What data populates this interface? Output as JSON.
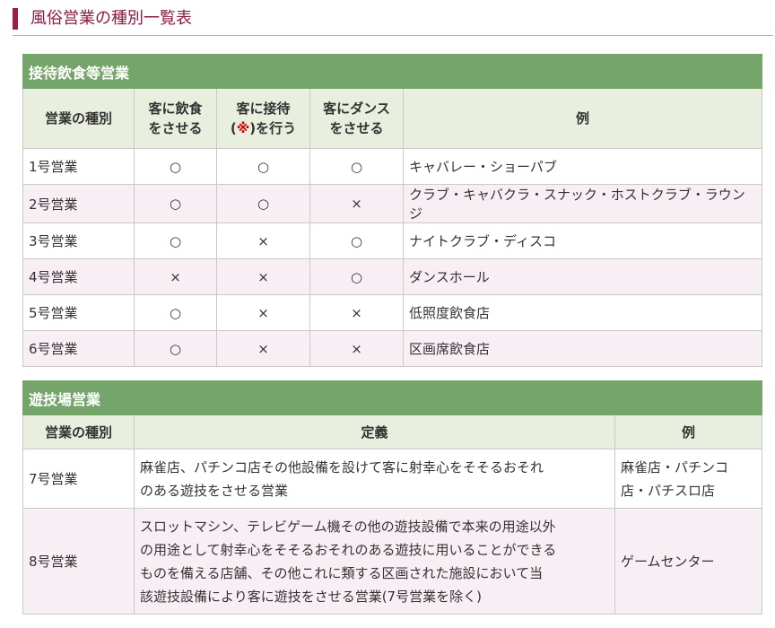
{
  "heading": {
    "title": "風俗営業の種別一覧表"
  },
  "table1": {
    "caption": "接待飲食等営業",
    "headers": {
      "type": "営業の種別",
      "food_1": "客に飲食",
      "food_2": "をさせる",
      "entertain_1": "客に接待",
      "entertain_2a": "(",
      "entertain_mark": "※",
      "entertain_2b": ")を行う",
      "dance_1": "客にダンス",
      "dance_2": "をさせる",
      "example": "例"
    },
    "rows": [
      {
        "type": "1号営業",
        "food": "○",
        "entertain": "○",
        "dance": "○",
        "example": "キャバレー・ショーパブ"
      },
      {
        "type": "2号営業",
        "food": "○",
        "entertain": "○",
        "dance": "×",
        "example": "クラブ・キャバクラ・スナック・ホストクラブ・ラウンジ"
      },
      {
        "type": "3号営業",
        "food": "○",
        "entertain": "×",
        "dance": "○",
        "example": "ナイトクラブ・ディスコ"
      },
      {
        "type": "4号営業",
        "food": "×",
        "entertain": "×",
        "dance": "○",
        "example": "ダンスホール"
      },
      {
        "type": "5号営業",
        "food": "○",
        "entertain": "×",
        "dance": "×",
        "example": "低照度飲食店"
      },
      {
        "type": "6号営業",
        "food": "○",
        "entertain": "×",
        "dance": "×",
        "example": "区画席飲食店"
      }
    ]
  },
  "table2": {
    "caption": "遊技場営業",
    "headers": {
      "type": "営業の種別",
      "definition": "定義",
      "example": "例"
    },
    "rows": [
      {
        "type": "7号営業",
        "definition_lines": [
          "麻雀店、パチンコ店その他設備を設けて客に射幸心をそそるおそれ",
          "のある遊技をさせる営業"
        ],
        "example_lines": [
          "麻雀店・パチンコ",
          "店・パチスロ店"
        ]
      },
      {
        "type": "8号営業",
        "definition_lines": [
          "スロットマシン、テレビゲーム機その他の遊技設備で本来の用途以外",
          "の用途として射幸心をそそるおそれのある遊技に用いることができる",
          "ものを備える店舗、その他これに類する区画された施設において当",
          "該遊技設備により客に遊技をさせる営業(7号営業を除く)"
        ],
        "example_lines": [
          "ゲームセンター"
        ]
      }
    ]
  }
}
